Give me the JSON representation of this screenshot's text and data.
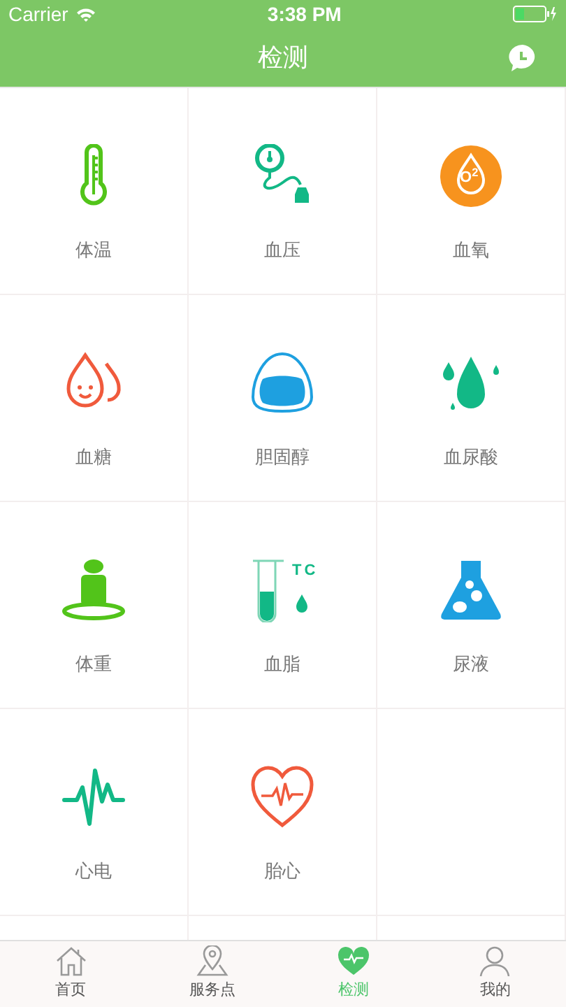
{
  "status_bar": {
    "carrier": "Carrier",
    "time": "3:38 PM"
  },
  "nav": {
    "title": "检测"
  },
  "tests": [
    {
      "label": "体温",
      "kind": "thermometer"
    },
    {
      "label": "血压",
      "kind": "blood-pressure"
    },
    {
      "label": "血氧",
      "kind": "oxygen",
      "icon_text": "O$^{2}$"
    },
    {
      "label": "血糖",
      "kind": "sugar"
    },
    {
      "label": "胆固醇",
      "kind": "cholesterol"
    },
    {
      "label": "血尿酸",
      "kind": "uric"
    },
    {
      "label": "体重",
      "kind": "weight"
    },
    {
      "label": "血脂",
      "kind": "lipid",
      "icon_text": "TC"
    },
    {
      "label": "尿液",
      "kind": "urine"
    },
    {
      "label": "心电",
      "kind": "ecg"
    },
    {
      "label": "胎心",
      "kind": "fetal"
    }
  ],
  "tab_bar": [
    {
      "label": "首页",
      "kind": "home",
      "selected": false
    },
    {
      "label": "服务点",
      "kind": "pin",
      "selected": false
    },
    {
      "label": "检测",
      "kind": "heart",
      "selected": true
    },
    {
      "label": "我的",
      "kind": "person",
      "selected": false
    }
  ]
}
